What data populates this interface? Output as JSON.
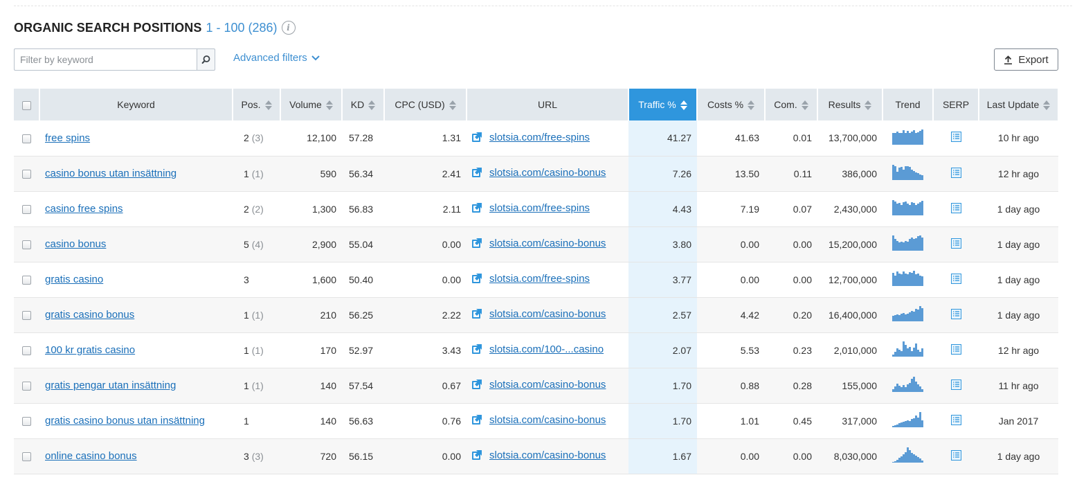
{
  "header": {
    "title": "ORGANIC SEARCH POSITIONS",
    "range": "1 - 100 (286)",
    "info_icon": "info-icon"
  },
  "filter": {
    "placeholder": "Filter by keyword",
    "value": "",
    "search_icon": "search-icon"
  },
  "advanced_filters": {
    "label": "Advanced filters",
    "icon": "chevron-down-icon"
  },
  "export": {
    "label": "Export",
    "icon": "upload-icon"
  },
  "columns": {
    "keyword": "Keyword",
    "pos": "Pos.",
    "volume": "Volume",
    "kd": "KD",
    "cpc": "CPC (USD)",
    "url": "URL",
    "traffic": "Traffic %",
    "costs": "Costs %",
    "com": "Com.",
    "results": "Results",
    "trend": "Trend",
    "serp": "SERP",
    "last_update": "Last Update"
  },
  "sorted_column": "traffic",
  "colors": {
    "accent": "#2f96dd",
    "link": "#1a6fb9",
    "sparkline": "#5b9bd5",
    "sorted_column_bg": "#e6f3fc",
    "header_bg": "#e2e8ed"
  },
  "rows": [
    {
      "keyword": "free spins",
      "pos": "2",
      "prev": "(3)",
      "volume": "12,100",
      "kd": "57.28",
      "cpc": "1.31",
      "url": "slotsia.com/free-spins",
      "traffic": "41.27",
      "costs": "41.63",
      "com": "0.01",
      "results": "13,700,000",
      "trend": [
        0.75,
        0.75,
        0.85,
        0.75,
        0.75,
        0.95,
        0.75,
        0.9,
        0.75,
        0.85,
        0.95,
        0.75,
        0.8,
        0.9,
        1.0
      ],
      "last_update": "10 hr ago"
    },
    {
      "keyword": "casino bonus utan insättning",
      "pos": "1",
      "prev": "(1)",
      "volume": "590",
      "kd": "56.34",
      "cpc": "2.41",
      "url": "slotsia.com/casino-bonus",
      "traffic": "7.26",
      "costs": "13.50",
      "com": "0.11",
      "results": "386,000",
      "trend": [
        1.0,
        0.9,
        0.55,
        0.8,
        0.85,
        0.7,
        0.9,
        0.9,
        0.85,
        0.7,
        0.6,
        0.5,
        0.45,
        0.35,
        0.3
      ],
      "last_update": "12 hr ago"
    },
    {
      "keyword": "casino free spins",
      "pos": "2",
      "prev": "(2)",
      "volume": "1,300",
      "kd": "56.83",
      "cpc": "2.11",
      "url": "slotsia.com/free-spins",
      "traffic": "4.43",
      "costs": "7.19",
      "com": "0.07",
      "results": "2,430,000",
      "trend": [
        1.0,
        0.9,
        0.75,
        0.8,
        0.7,
        0.85,
        0.9,
        0.75,
        0.7,
        0.85,
        0.8,
        0.7,
        0.75,
        0.85,
        0.95
      ],
      "last_update": "1 day ago"
    },
    {
      "keyword": "casino bonus",
      "pos": "5",
      "prev": "(4)",
      "volume": "2,900",
      "kd": "55.04",
      "cpc": "0.00",
      "url": "slotsia.com/casino-bonus",
      "traffic": "3.80",
      "costs": "0.00",
      "com": "0.00",
      "results": "15,200,000",
      "trend": [
        1.0,
        0.75,
        0.65,
        0.55,
        0.6,
        0.55,
        0.65,
        0.6,
        0.75,
        0.85,
        0.75,
        0.8,
        0.95,
        1.0,
        0.85
      ],
      "last_update": "1 day ago"
    },
    {
      "keyword": "gratis casino",
      "pos": "3",
      "prev": "",
      "volume": "1,600",
      "kd": "50.40",
      "cpc": "0.00",
      "url": "slotsia.com/free-spins",
      "traffic": "3.77",
      "costs": "0.00",
      "com": "0.00",
      "results": "12,700,000",
      "trend": [
        0.85,
        0.7,
        0.95,
        0.8,
        0.75,
        0.95,
        0.8,
        0.75,
        0.9,
        0.85,
        1.0,
        0.75,
        0.8,
        0.7,
        0.65
      ],
      "last_update": "1 day ago"
    },
    {
      "keyword": "gratis casino bonus",
      "pos": "1",
      "prev": "(1)",
      "volume": "210",
      "kd": "56.25",
      "cpc": "2.22",
      "url": "slotsia.com/casino-bonus",
      "traffic": "2.57",
      "costs": "4.42",
      "com": "0.20",
      "results": "16,400,000",
      "trend": [
        0.35,
        0.4,
        0.45,
        0.4,
        0.5,
        0.55,
        0.45,
        0.5,
        0.6,
        0.7,
        0.65,
        0.8,
        0.75,
        1.0,
        0.85
      ],
      "last_update": "1 day ago"
    },
    {
      "keyword": "100 kr gratis casino",
      "pos": "1",
      "prev": "(1)",
      "volume": "170",
      "kd": "52.97",
      "cpc": "3.43",
      "url": "slotsia.com/100-...casino",
      "traffic": "2.07",
      "costs": "5.53",
      "com": "0.23",
      "results": "2,010,000",
      "trend": [
        0.15,
        0.3,
        0.55,
        0.45,
        0.35,
        1.0,
        0.75,
        0.55,
        0.65,
        0.35,
        0.6,
        0.85,
        0.45,
        0.3,
        0.55
      ],
      "last_update": "12 hr ago"
    },
    {
      "keyword": "gratis pengar utan insättning",
      "pos": "1",
      "prev": "(1)",
      "volume": "140",
      "kd": "57.54",
      "cpc": "0.67",
      "url": "slotsia.com/casino-bonus",
      "traffic": "1.70",
      "costs": "0.88",
      "com": "0.28",
      "results": "155,000",
      "trend": [
        0.2,
        0.35,
        0.55,
        0.4,
        0.3,
        0.45,
        0.3,
        0.5,
        0.6,
        0.85,
        1.0,
        0.7,
        0.5,
        0.35,
        0.2
      ],
      "last_update": "11 hr ago"
    },
    {
      "keyword": "gratis casino bonus utan insättning",
      "pos": "1",
      "prev": "",
      "volume": "140",
      "kd": "56.63",
      "cpc": "0.76",
      "url": "slotsia.com/casino-bonus",
      "traffic": "1.70",
      "costs": "1.01",
      "com": "0.45",
      "results": "317,000",
      "trend": [
        0.1,
        0.15,
        0.2,
        0.25,
        0.3,
        0.35,
        0.4,
        0.45,
        0.4,
        0.55,
        0.6,
        0.75,
        0.65,
        1.0,
        0.45
      ],
      "last_update": "Jan 2017"
    },
    {
      "keyword": "online casino bonus",
      "pos": "3",
      "prev": "(3)",
      "volume": "720",
      "kd": "56.15",
      "cpc": "0.00",
      "url": "slotsia.com/casino-bonus",
      "traffic": "1.67",
      "costs": "0.00",
      "com": "0.00",
      "results": "8,030,000",
      "trend": [
        0.05,
        0.1,
        0.2,
        0.3,
        0.4,
        0.55,
        0.7,
        1.0,
        0.8,
        0.65,
        0.55,
        0.45,
        0.35,
        0.25,
        0.15
      ],
      "last_update": "1 day ago"
    }
  ]
}
